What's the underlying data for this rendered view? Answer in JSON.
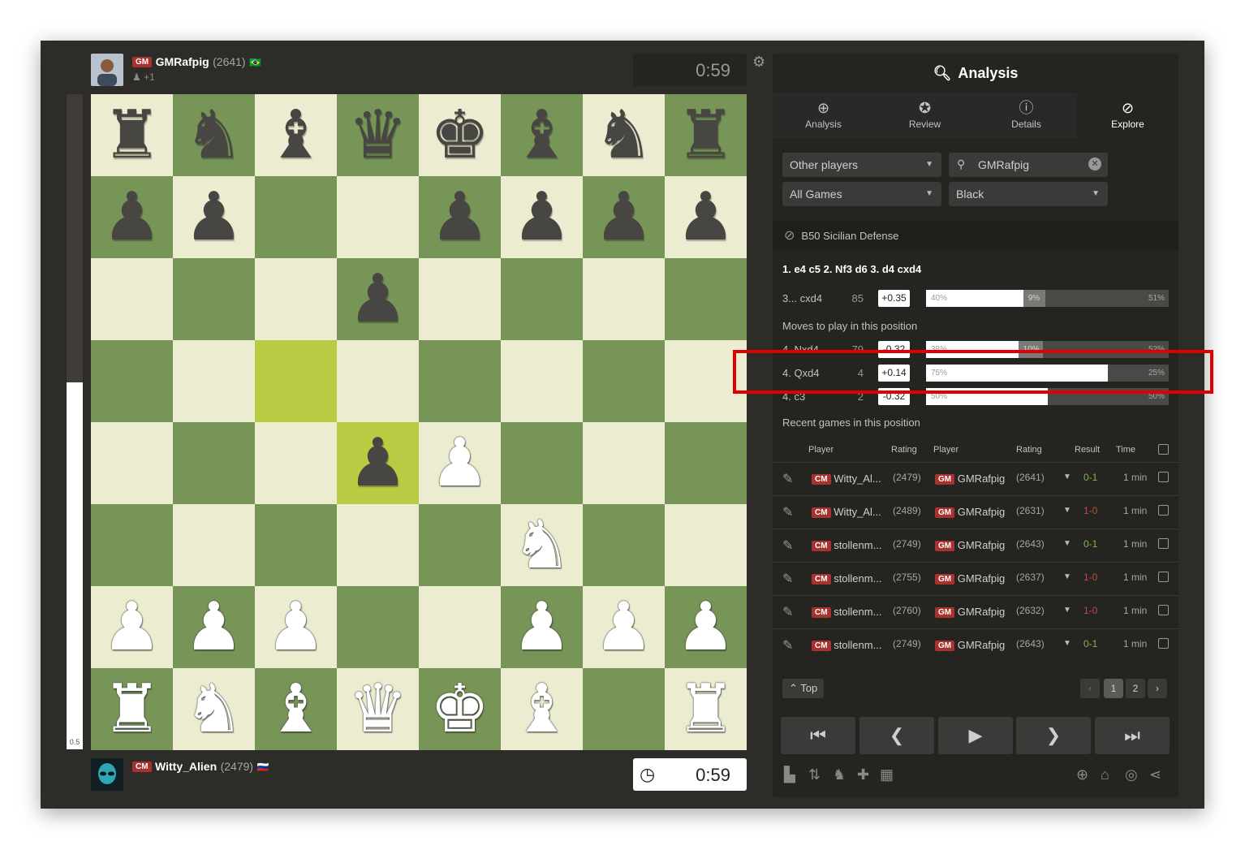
{
  "top_player": {
    "title": "GM",
    "name": "GMRafpig",
    "rating": "(2641)",
    "flag": "🇧🇷",
    "sub": "+1",
    "clock": "0:59"
  },
  "bottom_player": {
    "title": "CM",
    "name": "Witty_Alien",
    "rating": "(2479)",
    "flag": "🇷🇺",
    "clock": "0:59"
  },
  "eval_bar": {
    "label": "0.5",
    "white_fraction": 0.56
  },
  "board": {
    "orientation": "white",
    "ranks": [
      [
        "r",
        "n",
        "b",
        "q",
        "k",
        "b",
        "n",
        "r"
      ],
      [
        "p",
        "p",
        "",
        "",
        "p",
        "p",
        "p",
        "p"
      ],
      [
        "",
        "",
        "",
        "p",
        "",
        "",
        "",
        ""
      ],
      [
        "",
        "",
        "",
        "",
        "",
        "",
        "",
        ""
      ],
      [
        "",
        "",
        "",
        "p",
        "P",
        "",
        "",
        ""
      ],
      [
        "",
        "",
        "",
        "",
        "",
        "N",
        "",
        ""
      ],
      [
        "P",
        "P",
        "P",
        "",
        "",
        "P",
        "P",
        "P"
      ],
      [
        "R",
        "N",
        "B",
        "Q",
        "K",
        "B",
        "",
        "R"
      ]
    ],
    "highlight_squares": [
      "c5",
      "d4"
    ]
  },
  "panel": {
    "title": "Analysis",
    "tabs": [
      {
        "label": "Analysis",
        "icon": "analysis-icon"
      },
      {
        "label": "Review",
        "icon": "star-icon"
      },
      {
        "label": "Details",
        "icon": "info-icon"
      },
      {
        "label": "Explore",
        "icon": "compass-icon"
      }
    ],
    "active_tab": "Explore",
    "filters": {
      "players": "Other players",
      "search": "GMRafpig",
      "games": "All Games",
      "color": "Black"
    },
    "opening": "B50 Sicilian Defense",
    "line": "1. e4 c5 2. Nf3 d6 3. d4 cxd4",
    "current_move": {
      "move": "3... cxd4",
      "count": "85",
      "eval": "+0.35",
      "white": "40%",
      "draw": "9%",
      "black": "51%",
      "white_pct": 40,
      "draw_pct": 9
    },
    "moves_label": "Moves to play in this position",
    "moves": [
      {
        "move": "4. Nxd4",
        "count": "79",
        "eval": "-0.32",
        "white": "38%",
        "draw": "10%",
        "black": "52%",
        "white_pct": 38,
        "draw_pct": 10
      },
      {
        "move": "4. Qxd4",
        "count": "4",
        "eval": "+0.14",
        "white": "75%",
        "draw": "",
        "black": "25%",
        "white_pct": 75,
        "draw_pct": 0
      },
      {
        "move": "4. c3",
        "count": "2",
        "eval": "-0.32",
        "white": "50%",
        "draw": "",
        "black": "50%",
        "white_pct": 50,
        "draw_pct": 0
      }
    ],
    "recent_label": "Recent games in this position",
    "games_header": {
      "player1": "Player",
      "rating1": "Rating",
      "player2": "Player",
      "rating2": "Rating",
      "result": "Result",
      "time": "Time"
    },
    "games": [
      {
        "t1": "CM",
        "p1": "Witty_Al...",
        "r1": "(2479)",
        "t2": "GM",
        "p2": "GMRafpig",
        "r2": "(2641)",
        "result": "0-1",
        "time": "1 min"
      },
      {
        "t1": "CM",
        "p1": "Witty_Al...",
        "r1": "(2489)",
        "t2": "GM",
        "p2": "GMRafpig",
        "r2": "(2631)",
        "result": "1-0",
        "time": "1 min"
      },
      {
        "t1": "CM",
        "p1": "stollenm...",
        "r1": "(2749)",
        "t2": "GM",
        "p2": "GMRafpig",
        "r2": "(2643)",
        "result": "0-1",
        "time": "1 min"
      },
      {
        "t1": "CM",
        "p1": "stollenm...",
        "r1": "(2755)",
        "t2": "GM",
        "p2": "GMRafpig",
        "r2": "(2637)",
        "result": "1-0",
        "time": "1 min"
      },
      {
        "t1": "CM",
        "p1": "stollenm...",
        "r1": "(2760)",
        "t2": "GM",
        "p2": "GMRafpig",
        "r2": "(2632)",
        "result": "1-0",
        "time": "1 min"
      },
      {
        "t1": "CM",
        "p1": "stollenm...",
        "r1": "(2749)",
        "t2": "GM",
        "p2": "GMRafpig",
        "r2": "(2643)",
        "result": "0-1",
        "time": "1 min"
      }
    ],
    "top_button": "Top",
    "pages": [
      "1",
      "2"
    ],
    "current_page": "1",
    "colors": {
      "win_color": "#c14b3f",
      "loss_color": "#81b64c",
      "highlight_box": "#e10000"
    }
  }
}
